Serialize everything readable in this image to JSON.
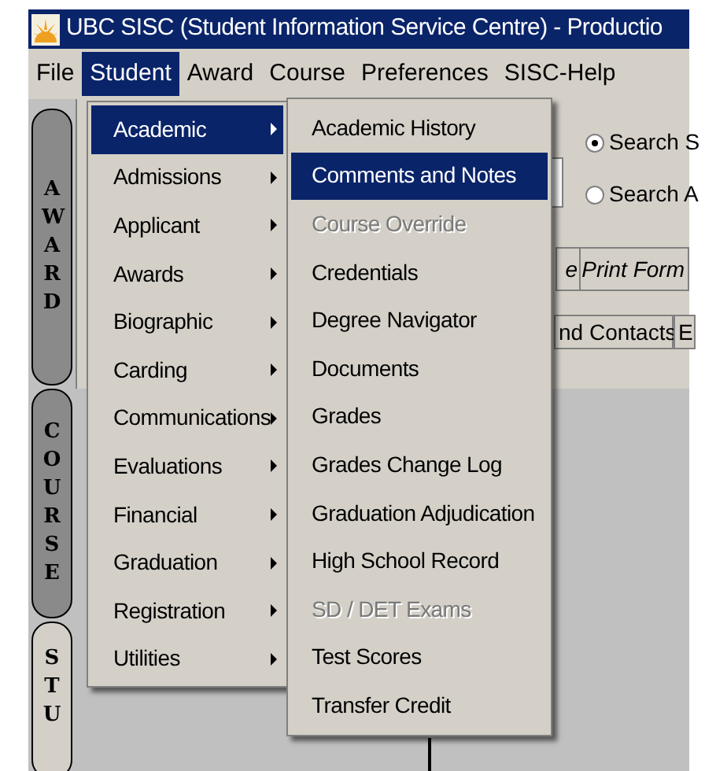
{
  "window": {
    "title": "UBC SISC (Student Information Service Centre) - Productio"
  },
  "menubar": [
    {
      "label": "File",
      "selected": false
    },
    {
      "label": "Student",
      "selected": true
    },
    {
      "label": "Award",
      "selected": false
    },
    {
      "label": "Course",
      "selected": false
    },
    {
      "label": "Preferences",
      "selected": false
    },
    {
      "label": "SISC-Help",
      "selected": false
    }
  ],
  "side_tabs": [
    {
      "label": "AWARD",
      "selected": false
    },
    {
      "label": "COURSE",
      "selected": false
    },
    {
      "label": "STU",
      "selected": true
    }
  ],
  "background": {
    "radios": [
      {
        "label": "Search S",
        "checked": true
      },
      {
        "label": "Search A",
        "checked": false
      }
    ],
    "buttons": [
      "e",
      "Print Form"
    ],
    "tabs": [
      "nd Contacts",
      "E"
    ]
  },
  "menu": [
    {
      "label": "Academic",
      "selected": true
    },
    {
      "label": "Admissions",
      "selected": false
    },
    {
      "label": "Applicant",
      "selected": false
    },
    {
      "label": "Awards",
      "selected": false
    },
    {
      "label": "Biographic",
      "selected": false
    },
    {
      "label": "Carding",
      "selected": false
    },
    {
      "label": "Communications",
      "selected": false
    },
    {
      "label": "Evaluations",
      "selected": false
    },
    {
      "label": "Financial",
      "selected": false
    },
    {
      "label": "Graduation",
      "selected": false
    },
    {
      "label": "Registration",
      "selected": false
    },
    {
      "label": "Utilities",
      "selected": false
    }
  ],
  "submenu": [
    {
      "label": "Academic History",
      "selected": false,
      "disabled": false
    },
    {
      "label": "Comments and Notes",
      "selected": true,
      "disabled": false
    },
    {
      "label": "Course Override",
      "selected": false,
      "disabled": true
    },
    {
      "label": "Credentials",
      "selected": false,
      "disabled": false
    },
    {
      "label": "Degree Navigator",
      "selected": false,
      "disabled": false
    },
    {
      "label": "Documents",
      "selected": false,
      "disabled": false
    },
    {
      "label": "Grades",
      "selected": false,
      "disabled": false
    },
    {
      "label": "Grades Change Log",
      "selected": false,
      "disabled": false
    },
    {
      "label": "Graduation Adjudication",
      "selected": false,
      "disabled": false
    },
    {
      "label": "High School Record",
      "selected": false,
      "disabled": false
    },
    {
      "label": "SD / DET Exams",
      "selected": false,
      "disabled": true
    },
    {
      "label": "Test Scores",
      "selected": false,
      "disabled": false
    },
    {
      "label": "Transfer Credit",
      "selected": false,
      "disabled": false
    }
  ]
}
